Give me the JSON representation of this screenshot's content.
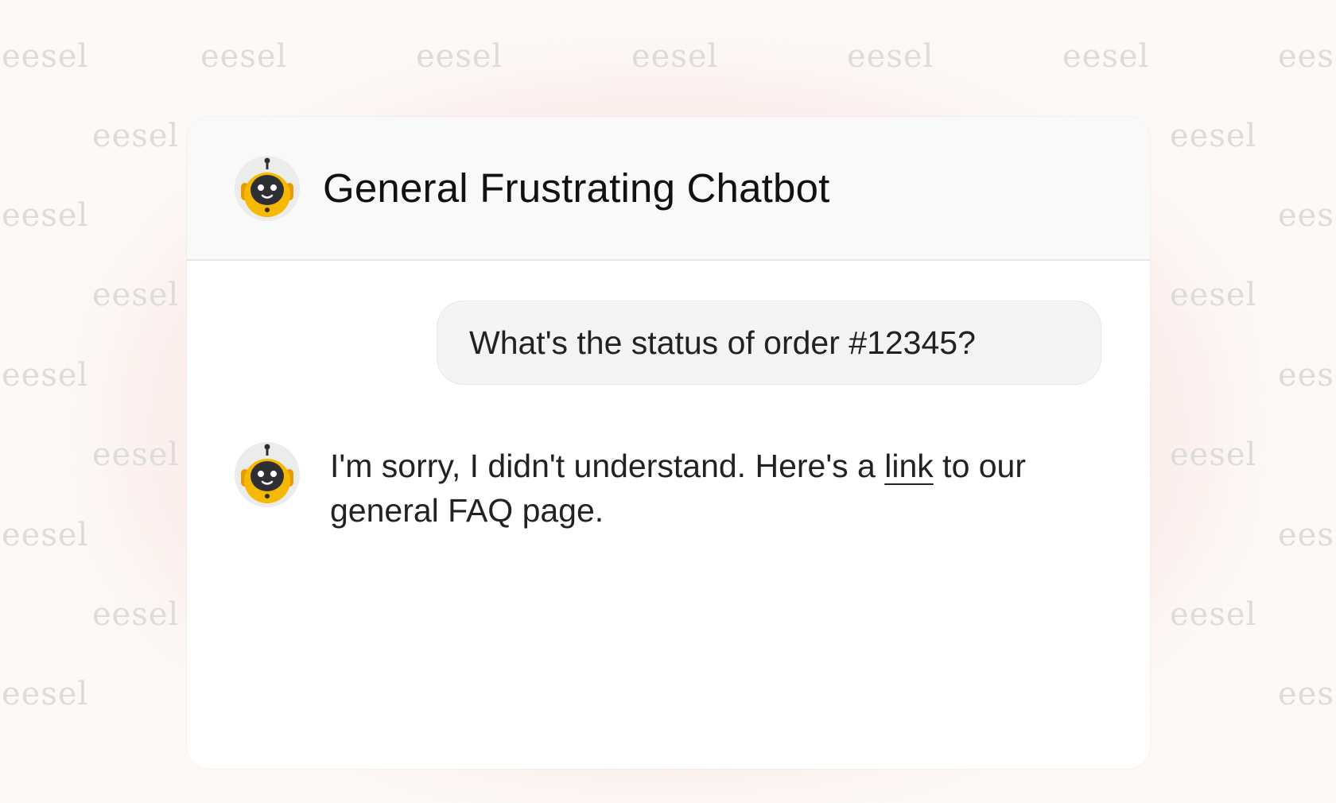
{
  "watermark": {
    "text": "eesel"
  },
  "header": {
    "title": "General Frustrating Chatbot",
    "avatar_icon": "robot-icon"
  },
  "messages": {
    "user": {
      "text": "What's the status of order #12345?"
    },
    "bot": {
      "avatar_icon": "robot-icon",
      "text_before_link": "I'm sorry, I didn't understand. Here's a ",
      "link_text": "link",
      "text_after_link": " to our general FAQ page."
    }
  },
  "colors": {
    "avatar_yellow": "#F6B800",
    "avatar_dark": "#2E2E35",
    "glow": "#FFB3B3"
  }
}
